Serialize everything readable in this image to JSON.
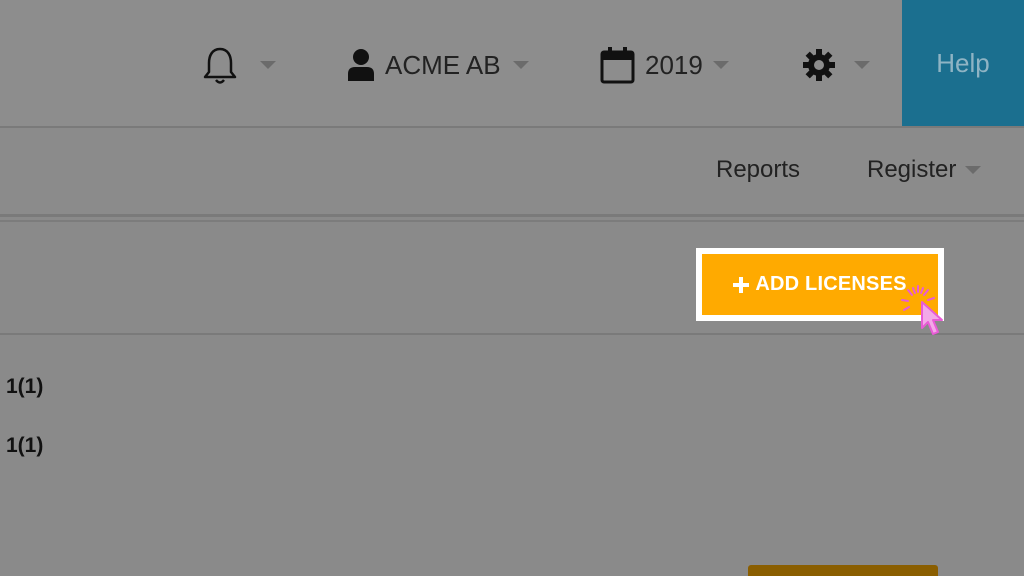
{
  "topbar": {
    "notifications_icon": "bell-icon",
    "account_icon": "user-icon",
    "account_label": "ACME AB",
    "year_icon": "calendar-icon",
    "year_label": "2019",
    "settings_icon": "gear-icon",
    "help_label": "Help",
    "help_color": "#1b6f8f"
  },
  "subnav": {
    "items": [
      {
        "label": "Reports"
      },
      {
        "label": "Register"
      }
    ]
  },
  "toolbar": {
    "add_licenses_label": "ADD LICENSES",
    "add_icon": "plus-icon",
    "accent_color": "#ffaa00"
  },
  "rows": [
    {
      "value": "1(1)"
    },
    {
      "value": "1(1)"
    }
  ]
}
